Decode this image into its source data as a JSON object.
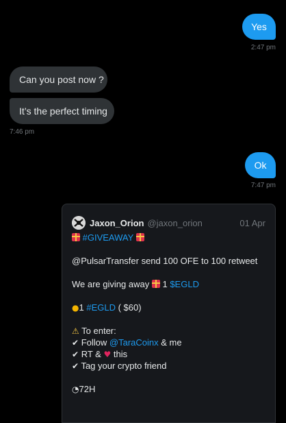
{
  "messages": {
    "m1": {
      "text": "Yes",
      "time": "2:47 pm"
    },
    "m2": {
      "text": "Can you post now ?"
    },
    "m3": {
      "text": "It’s the perfect timing",
      "time": "7:46 pm"
    },
    "m4": {
      "text": "Ok",
      "time": "7:47 pm"
    }
  },
  "tweet": {
    "name": "Jaxon_Orion",
    "handle": "@jaxon_orion",
    "date": "01 Apr",
    "hashtag_giveaway": "#GIVEAWAY",
    "line_send": "@PulsarTransfer send 100 OFE to 100 retweet",
    "line_giving_prefix": "We are giving away",
    "line_giving_amount": "1",
    "cashtag": "$EGLD",
    "prize_count": "1",
    "prize_hashtag": "#EGLD",
    "prize_value": "( $60)",
    "enter_label": "To enter:",
    "follow_label": "Follow",
    "follow_mention": "@TaraCoinx",
    "follow_suffix": "& me",
    "rt_prefix": "RT &",
    "rt_suffix": "this",
    "tag_label": "Tag your crypto friend",
    "duration": "72H"
  },
  "icons": {
    "gift": "gift-icon",
    "medal": "medal-icon",
    "warning": "warning-icon",
    "check": "check-icon",
    "heart": "heart-icon",
    "clock": "clock-icon"
  },
  "colors": {
    "outgoing_bubble": "#1d9bf0",
    "incoming_bubble": "#2f3336",
    "link": "#1d9bf0",
    "background": "#000000"
  }
}
